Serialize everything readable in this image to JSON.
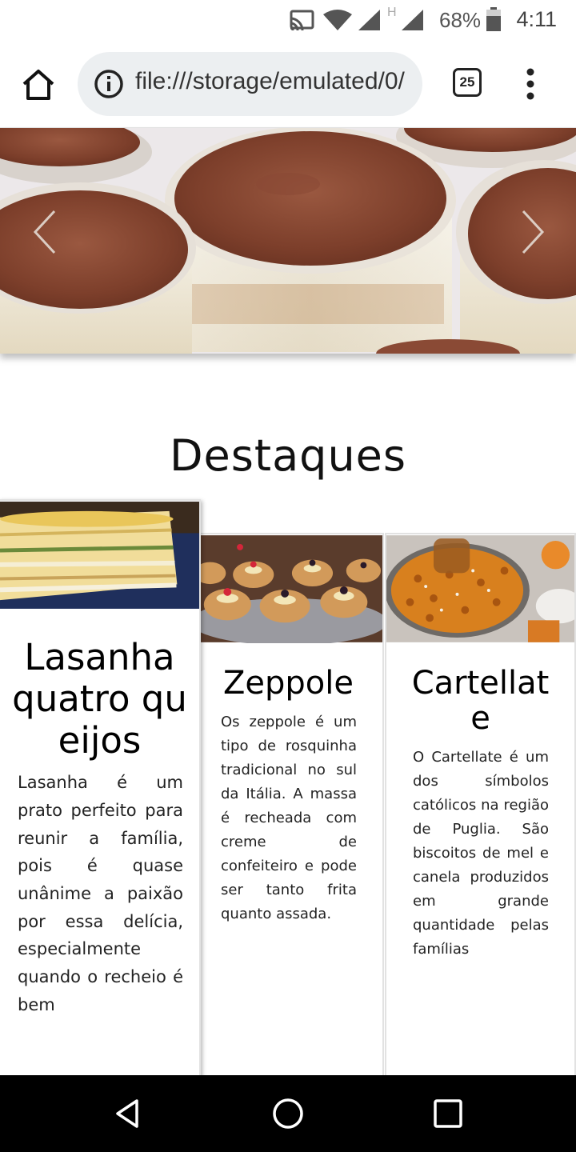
{
  "status_bar": {
    "battery": "68%",
    "network": "H",
    "time": "4:11"
  },
  "browser": {
    "url": "file:///storage/emulated/0/",
    "tab_count": "25"
  },
  "section": {
    "title": "Destaques"
  },
  "cards": [
    {
      "title": "Lasanha quatro queijos",
      "text": "Lasanha é um prato perfeito para reunir a família, pois é quase unânime a paixão por essa delícia, especialmente quando o recheio é bem"
    },
    {
      "title": "Zeppole",
      "text": "Os zeppole é um tipo de rosquinha tradicional no sul da Itália. A massa é recheada com creme de confeiteiro e pode ser tanto frita quanto assada."
    },
    {
      "title": "Cartellate",
      "text": "O Cartellate é um dos símbolos católicos na região de Puglia. São biscoitos de mel e canela produzidos em grande quantidade pelas famílias"
    }
  ],
  "colors": {
    "url_bar_bg": "#eceff1",
    "cocoa": "#8a4a35",
    "nav_bar": "#000000"
  },
  "icons": [
    "cast-icon",
    "wifi-icon",
    "signal-icon",
    "battery-icon",
    "home-icon",
    "info-icon",
    "tabs-icon",
    "more-vert-icon",
    "chevron-left-icon",
    "chevron-right-icon",
    "back-icon",
    "home-circle-icon",
    "recents-icon"
  ]
}
